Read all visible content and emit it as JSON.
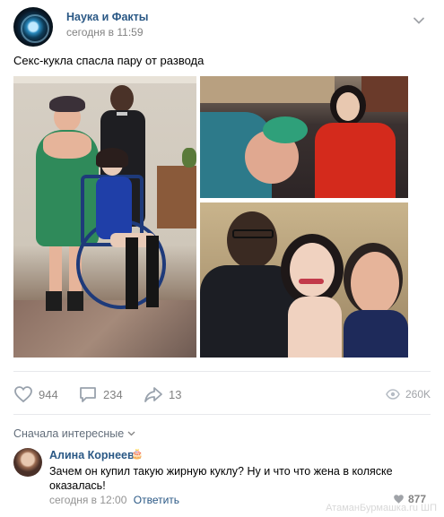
{
  "post": {
    "group_name": "Наука и Факты",
    "time": "сегодня в 11:59",
    "text": "Секс-кукла спасла пару от развода",
    "menu_icon": "chevron-down-icon"
  },
  "actions": {
    "likes": "944",
    "comments": "234",
    "shares": "13",
    "views": "260K"
  },
  "comments_section": {
    "sort_label": "Сначала интересные",
    "items": [
      {
        "author": "Алина Корнеева",
        "badge": "🎂",
        "text": "Зачем он купил такую жирную куклу? Ну и что что жена в коляске оказалась!",
        "time": "сегодня в 12:00",
        "reply_label": "Ответить",
        "likes": "877"
      }
    ]
  },
  "watermark": "АтаманБурмашка.ru ШП",
  "colors": {
    "link": "#2a5885",
    "meta": "#828282",
    "divider": "#e7e8ec"
  }
}
